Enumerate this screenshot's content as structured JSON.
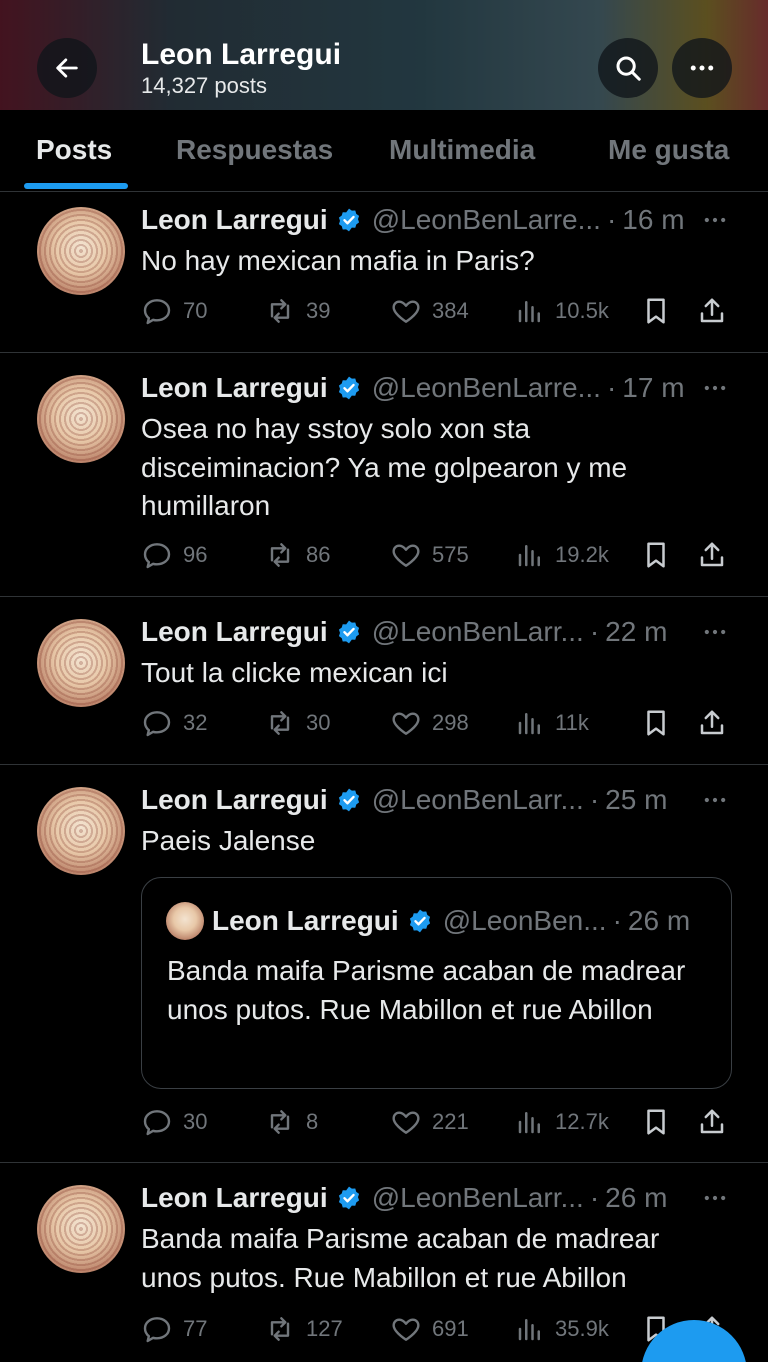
{
  "header": {
    "title": "Leon Larregui",
    "post_count": "14,327 posts"
  },
  "tabs": [
    "Posts",
    "Respuestas",
    "Multimedia",
    "Me gusta"
  ],
  "tweets": [
    {
      "name": "Leon Larregui",
      "handle": "@LeonBenLarre...",
      "time": "16 m",
      "text": "No hay mexican mafia in Paris?",
      "replies": "70",
      "retweets": "39",
      "likes": "384",
      "views": "10.5k"
    },
    {
      "name": "Leon Larregui",
      "handle": "@LeonBenLarre...",
      "time": "17 m",
      "text": "Osea no hay sstoy solo xon sta disceiminacion? Ya me golpearon y me humillaron",
      "replies": "96",
      "retweets": "86",
      "likes": "575",
      "views": "19.2k"
    },
    {
      "name": "Leon Larregui",
      "handle": "@LeonBenLarr...",
      "time": "22 m",
      "text": "Tout la clicke  mexican ici",
      "replies": "32",
      "retweets": "30",
      "likes": "298",
      "views": "11k"
    },
    {
      "name": "Leon Larregui",
      "handle": "@LeonBenLarr...",
      "time": "25 m",
      "text": "Paeis Jalense",
      "quote": {
        "name": "Leon Larregui",
        "handle": "@LeonBen...",
        "time": "26 m",
        "text": "Banda maifa Parisme acaban de madrear unos putos. Rue Mabillon et rue Abillon"
      },
      "replies": "30",
      "retweets": "8",
      "likes": "221",
      "views": "12.7k"
    },
    {
      "name": "Leon Larregui",
      "handle": "@LeonBenLarr...",
      "time": "26 m",
      "text": "Banda maifa Parisme acaban de madrear unos putos. Rue Mabillon et rue Abillon",
      "replies": "77",
      "retweets": "127",
      "likes": "691",
      "views": "35.9k"
    }
  ],
  "dot_separator": "·",
  "colors": {
    "accent": "#1d9bf0",
    "muted": "#71767b",
    "text": "#e7e9ea",
    "divider": "#2f3336"
  },
  "icons": [
    "back-arrow-icon",
    "search-icon",
    "more-icon",
    "verified-badge-icon",
    "reply-icon",
    "retweet-icon",
    "like-icon",
    "views-icon",
    "bookmark-icon",
    "share-icon",
    "compose-fab"
  ]
}
